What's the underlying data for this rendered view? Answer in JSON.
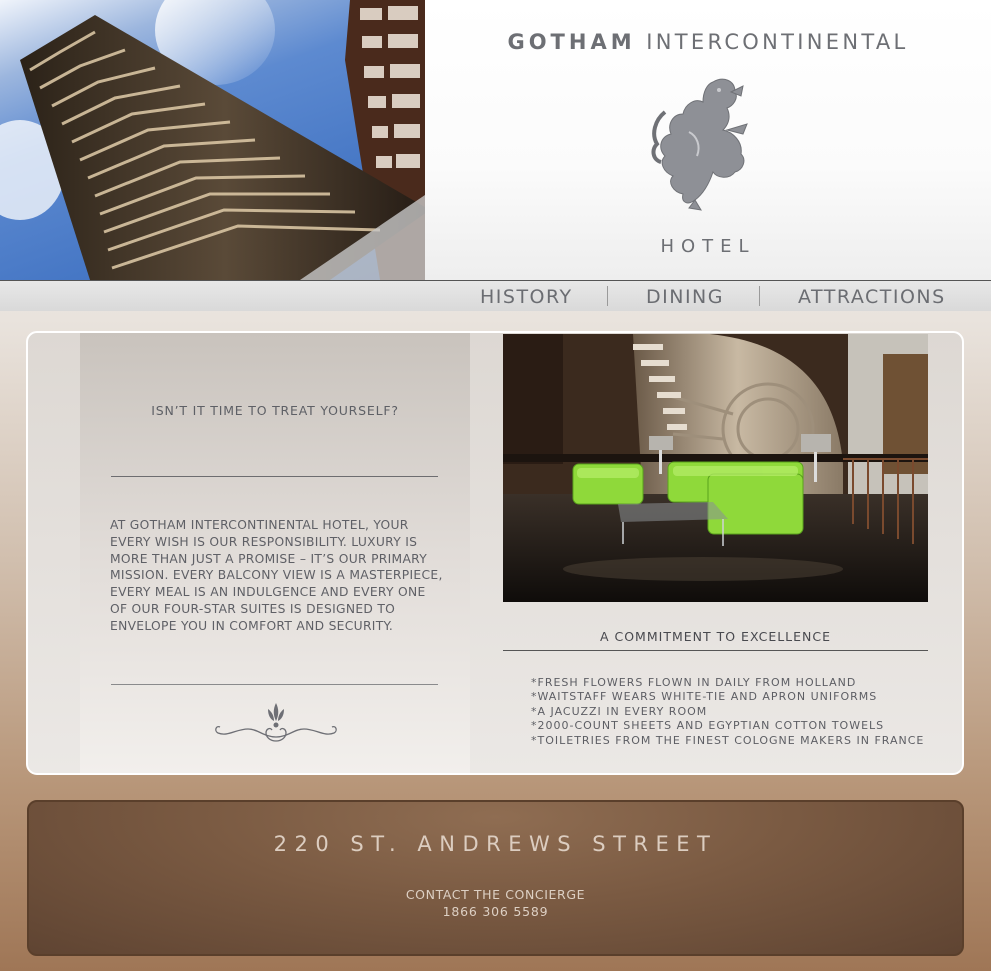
{
  "brand": {
    "title_bold": "GOTHAM",
    "title_rest": "INTERCONTINENTAL",
    "subtitle": "HOTEL",
    "emblem_icon": "rampant-lion-icon"
  },
  "nav": {
    "items": [
      {
        "label": "HISTORY"
      },
      {
        "label": "DINING"
      },
      {
        "label": "ATTRACTIONS"
      }
    ]
  },
  "intro": {
    "heading": "ISN’T IT TIME TO TREAT YOURSELF?",
    "body": "AT GOTHAM INTERCONTINENTAL HOTEL, YOUR EVERY WISH IS OUR RESPONSIBILITY.  LUXURY IS MORE THAN JUST A PROMISE – IT’S OUR PRIMARY MISSION.  EVERY BALCONY VIEW IS A MASTERPIECE, EVERY MEAL IS AN INDULGENCE AND EVERY ONE OF OUR FOUR-STAR SUITES IS DESIGNED TO ENVELOPE YOU IN COMFORT AND SECURITY.",
    "ornament_icon": "flourish-ornament-icon"
  },
  "excellence": {
    "heading": "A COMMITMENT TO EXCELLENCE",
    "items": [
      "*FRESH FLOWERS FLOWN IN DAILY FROM HOLLAND",
      "*WAITSTAFF WEARS WHITE-TIE AND APRON UNIFORMS",
      "*A JACUZZI IN EVERY ROOM",
      "*2000-COUNT SHEETS AND EGYPTIAN COTTON TOWELS",
      "*TOILETRIES FROM THE FINEST COLOGNE MAKERS IN FRANCE"
    ]
  },
  "footer": {
    "address": "220 ST. ANDREWS STREET",
    "contact_label": "CONTACT THE CONCIERGE",
    "phone": "1866 306 5589"
  },
  "colors": {
    "text_gray": "#6d6f74",
    "footer_bg": "#7a5a42",
    "footer_text": "#dccdc0",
    "sofa_green": "#8fd93a"
  }
}
